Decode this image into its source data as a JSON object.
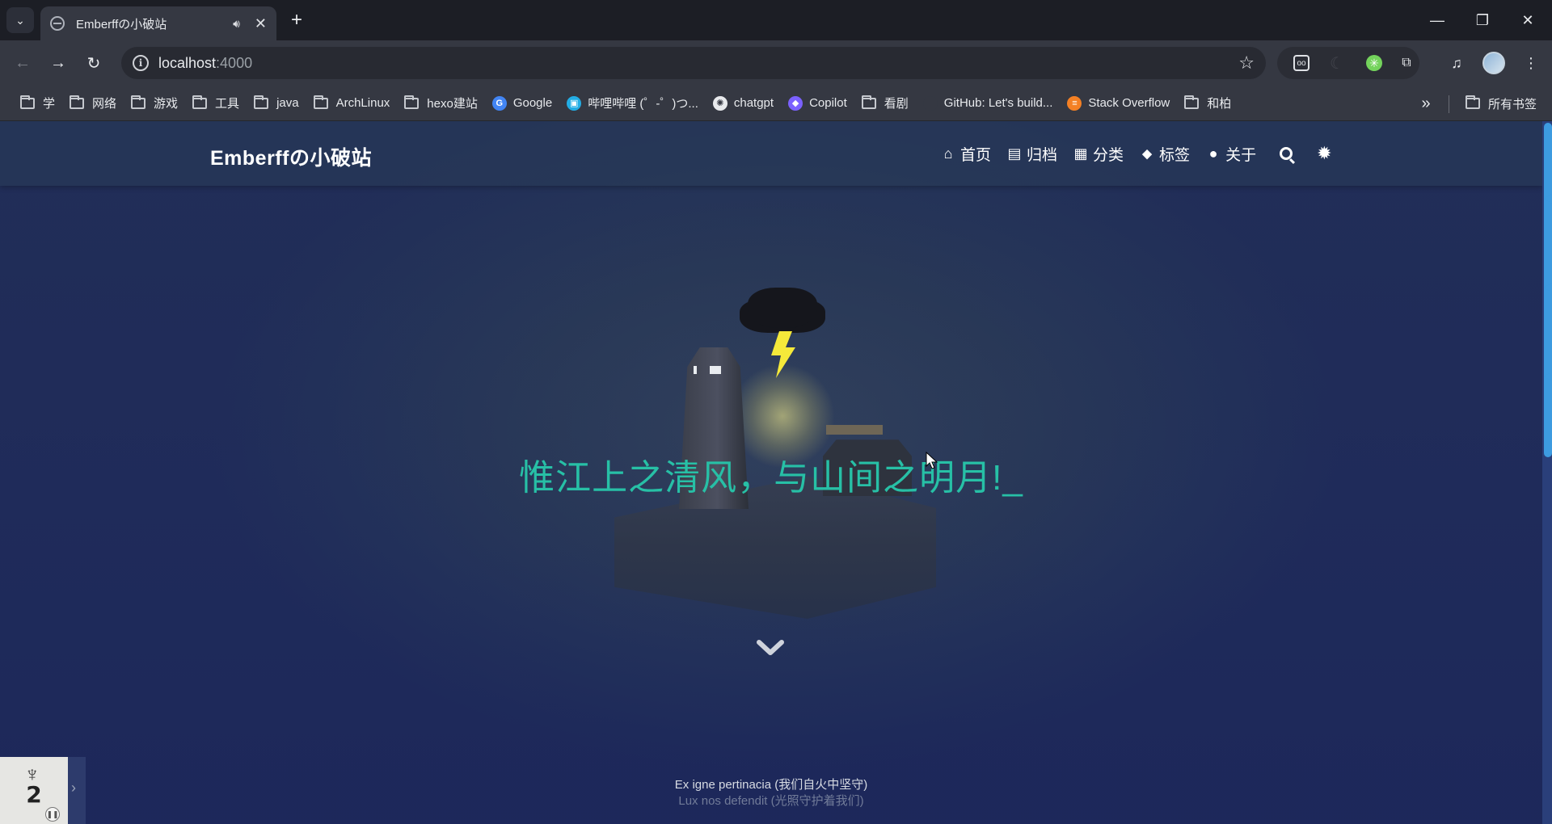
{
  "browser": {
    "tab": {
      "title": "Emberffの小破站"
    },
    "window_controls": {
      "minimize": "—",
      "restore": "❐",
      "close": "✕"
    },
    "url": {
      "host": "localhost",
      "port": ":4000"
    },
    "bookmarks": [
      {
        "label": "学",
        "kind": "folder"
      },
      {
        "label": "网络",
        "kind": "folder"
      },
      {
        "label": "游戏",
        "kind": "folder"
      },
      {
        "label": "工具",
        "kind": "folder"
      },
      {
        "label": "java",
        "kind": "folder"
      },
      {
        "label": "ArchLinux",
        "kind": "folder"
      },
      {
        "label": "hexo建站",
        "kind": "folder"
      },
      {
        "label": "Google",
        "kind": "site",
        "icon": "google-icon",
        "color": "#4285f4",
        "glyph": "G"
      },
      {
        "label": "哔哩哔哩 (゜-゜)つ...",
        "kind": "site",
        "icon": "bilibili-icon",
        "color": "#23ade5",
        "glyph": "▣"
      },
      {
        "label": "chatgpt",
        "kind": "site",
        "icon": "chatgpt-icon",
        "color": "#e8eaed",
        "glyph": "✺"
      },
      {
        "label": "Copilot",
        "kind": "site",
        "icon": "copilot-icon",
        "color": "#7b61ff",
        "glyph": "◆"
      },
      {
        "label": "看剧",
        "kind": "folder"
      },
      {
        "label": "GitHub: Let's build...",
        "kind": "site",
        "icon": "github-icon",
        "color": "#353842",
        "glyph": ""
      },
      {
        "label": "Stack Overflow",
        "kind": "site",
        "icon": "stackoverflow-icon",
        "color": "#f48024",
        "glyph": "≡"
      },
      {
        "label": "和柏",
        "kind": "folder"
      }
    ],
    "all_bookmarks": "所有书签"
  },
  "site": {
    "brand": "Emberffの小破站",
    "menu": [
      {
        "label": "首页",
        "icon": "home-icon"
      },
      {
        "label": "归档",
        "icon": "archive-icon"
      },
      {
        "label": "分类",
        "icon": "category-icon"
      },
      {
        "label": "标签",
        "icon": "tags-icon"
      },
      {
        "label": "关于",
        "icon": "user-icon"
      }
    ],
    "subtitle": "惟江上之清风，与山间之明月!_",
    "footer": {
      "line1": "Ex igne pertinacia (我们自火中坚守)",
      "line2": "Lux nos defendit (光照守护着我们)"
    },
    "player": {
      "cover_number": "2"
    }
  },
  "colors": {
    "accent_typing": "#27c0a6",
    "scrollbar_thumb": "#3d9be0",
    "bolt": "#f5e93a"
  }
}
